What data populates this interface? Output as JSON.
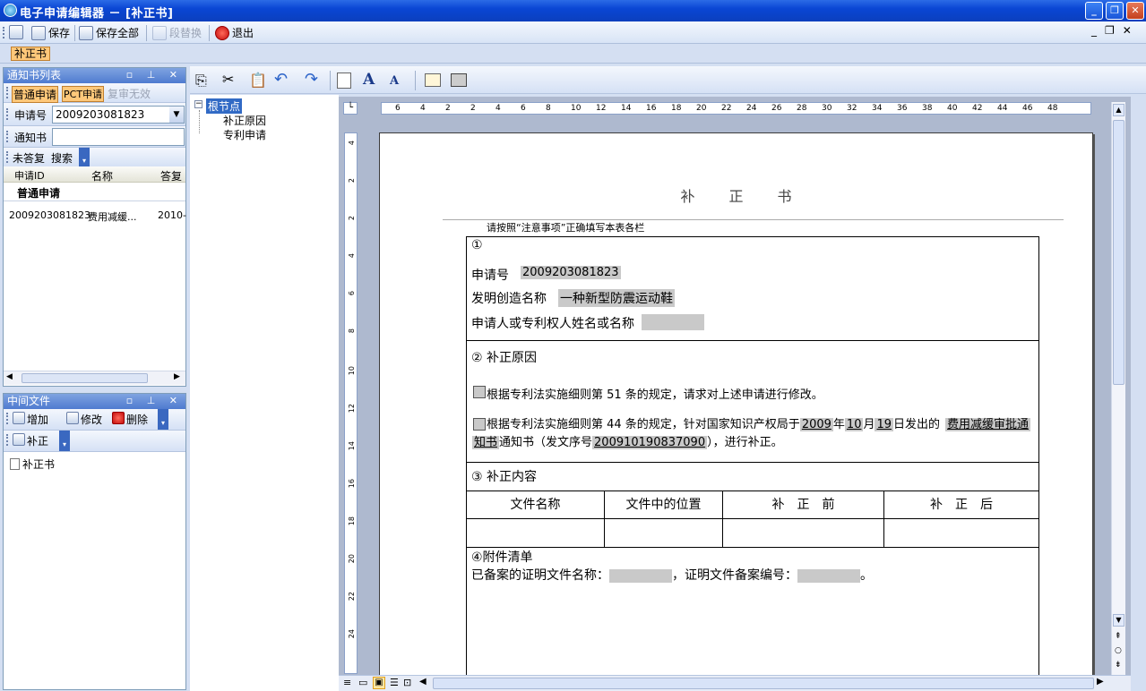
{
  "window": {
    "title": "电子申请编辑器 － [补正书]"
  },
  "toolbar": {
    "save": "保存",
    "save_all": "保存全部",
    "replace": "段替换",
    "exit": "退出"
  },
  "doc_tab": "补正书",
  "notice_panel": {
    "title": "通知书列表",
    "filters": [
      "普通申请",
      "PCT申请",
      "复审无效"
    ],
    "app_no_label": "申请号",
    "app_no_value": "2009203081823",
    "notice_label": "通知书",
    "unanswered": "未答复",
    "search": "搜索",
    "columns": [
      "申请ID",
      "名称",
      "答复"
    ],
    "group": "普通申请",
    "rows": [
      {
        "id": "2009203081823",
        "name": "费用减缓...",
        "reply": "2010-"
      }
    ]
  },
  "middle_panel": {
    "title": "中间文件",
    "add": "增加",
    "edit": "修改",
    "delete": "删除",
    "correction": "补正",
    "item": "补正书"
  },
  "tree": {
    "root": "根节点",
    "children": [
      "补正原因",
      "专利申请"
    ]
  },
  "ruler": {
    "h": [
      "6",
      "4",
      "2",
      "2",
      "4",
      "6",
      "8",
      "10",
      "12",
      "14",
      "16",
      "18",
      "20",
      "22",
      "24",
      "26",
      "28",
      "30",
      "32",
      "34",
      "36",
      "38",
      "40",
      "42",
      "44",
      "46",
      "48"
    ],
    "v": [
      "4",
      "2",
      "2",
      "4",
      "6",
      "8",
      "10",
      "12",
      "14",
      "16",
      "18",
      "20",
      "22",
      "24"
    ]
  },
  "document": {
    "title": "补　　正　　书",
    "note": "请按照“注意事项”正确填写本表各栏",
    "s1_num": "①",
    "app_no_label": "申请号",
    "app_no": "2009203081823",
    "invention_label": "发明创造名称",
    "invention": "一种新型防震运动鞋",
    "applicant_label": "申请人或专利权人姓名或名称",
    "s2_title": "②  补正原因",
    "reason1": "根据专利法实施细则第 51 条的规定，请求对上述申请进行修改。",
    "reason2_a": "根据专利法实施细则第 44 条的规定，针对国家知识产权局于",
    "year": "2009",
    "y": "年",
    "month": "10",
    "m": "月",
    "day": "19",
    "d": "日发出的",
    "notice_name_1": "费用减缓审批通",
    "notice_name_2": "知书",
    "reason2_b": "通知书（发文序号",
    "serial": "200910190837090",
    "reason2_c": "），进行补正。",
    "s3_title": "③  补正内容",
    "table_headers": [
      "文件名称",
      "文件中的位置",
      "补　正　前",
      "补　正　后"
    ],
    "s4_title": "④附件清单",
    "attach_a": "已备案的证明文件名称：",
    "attach_b": "，证明文件备案编号：",
    "attach_c": "。"
  }
}
